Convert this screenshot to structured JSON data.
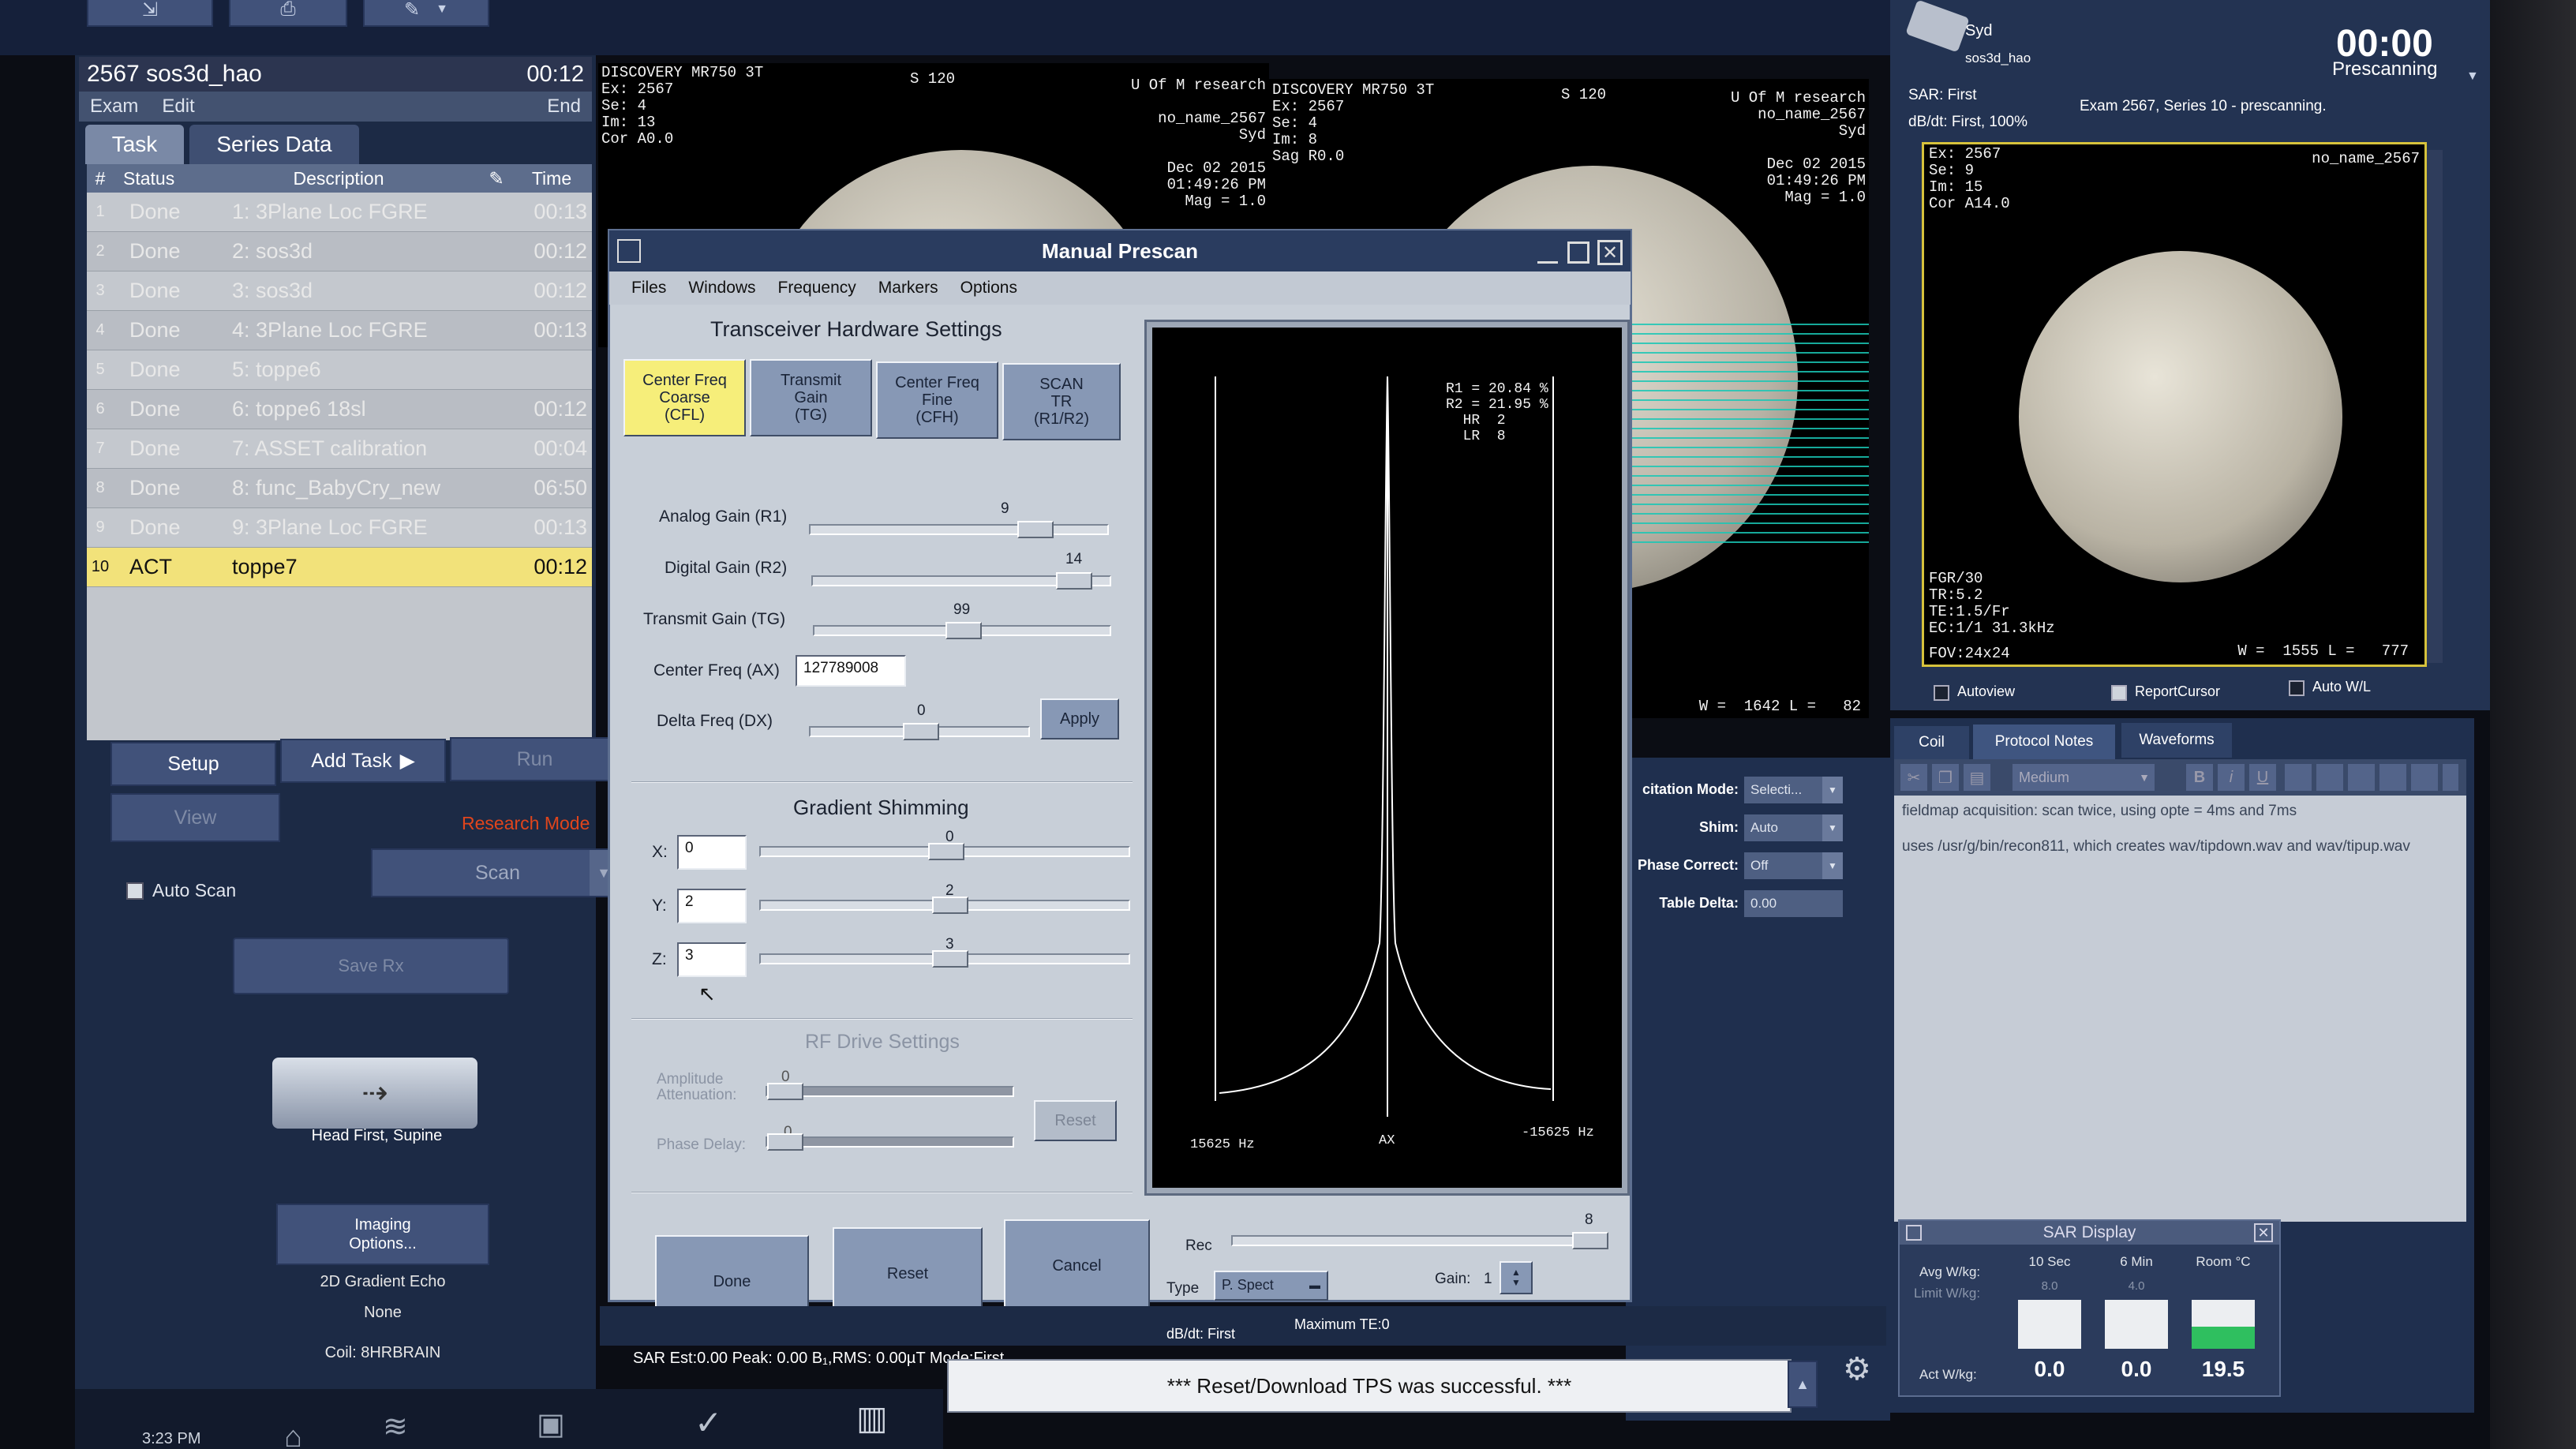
{
  "task_panel": {
    "patient": "2567 sos3d_hao",
    "time": "00:12",
    "menu": [
      "Exam",
      "Edit"
    ],
    "menu_end": "End",
    "tabs": [
      "Task",
      "Series Data"
    ],
    "columns": {
      "num": "#",
      "status": "Status",
      "description": "Description",
      "time": "Time"
    },
    "rows": [
      {
        "num": "1",
        "status": "Done",
        "description": "1: 3Plane Loc FGRE",
        "time": "00:13"
      },
      {
        "num": "2",
        "status": "Done",
        "description": "2: sos3d",
        "time": "00:12"
      },
      {
        "num": "3",
        "status": "Done",
        "description": "3: sos3d",
        "time": "00:12"
      },
      {
        "num": "4",
        "status": "Done",
        "description": "4: 3Plane Loc FGRE",
        "time": "00:13"
      },
      {
        "num": "5",
        "status": "Done",
        "description": "5: toppe6",
        "time": ""
      },
      {
        "num": "6",
        "status": "Done",
        "description": "6: toppe6 18sl",
        "time": "00:12"
      },
      {
        "num": "7",
        "status": "Done",
        "description": "7: ASSET calibration",
        "time": "00:04"
      },
      {
        "num": "8",
        "status": "Done",
        "description": "8: func_BabyCry_new",
        "time": "06:50"
      },
      {
        "num": "9",
        "status": "Done",
        "description": "9: 3Plane Loc FGRE",
        "time": "00:13"
      },
      {
        "num": "10",
        "status": "ACT",
        "description": "toppe7",
        "time": "00:12"
      }
    ],
    "buttons": {
      "setup": "Setup",
      "add_task": "Add Task",
      "run": "Run",
      "view": "View",
      "scan": "Scan"
    },
    "research_mode": "Research Mode",
    "auto_scan": "Auto Scan",
    "save_rx": "Save Rx",
    "position": "Head First, Supine",
    "imaging_options": "Imaging Options...",
    "sequence": "2D Gradient Echo",
    "sequence_opt": "None",
    "coil": "Coil: 8HRBRAIN",
    "clock": "3:23 PM"
  },
  "viewport1": {
    "left_text": "DISCOVERY MR750 3T\nEx: 2567\nSe: 4\nIm: 13\nCor A0.0",
    "top_center": "S 120",
    "right_text": "U Of M research\n\nno_name_2567\nSyd\n\nDec 02 2015\n01:49:26 PM\nMag = 1.0"
  },
  "viewport2": {
    "left_text": "DISCOVERY MR750 3T\nEx: 2567\nSe: 4\nIm: 8\nSag R0.0",
    "top_center": "S 120",
    "right_text": "U Of M research\nno_name_2567\nSyd\n\nDec 02 2015\n01:49:26 PM\nMag = 1.0",
    "bottom": "W =  1642 L =   82"
  },
  "viewport3": {
    "left_text": "Ex: 2567\nSe: 9\nIm: 15\nCor A14.0",
    "right_text": "no_name_2567",
    "bottom_left": "FGR/30\nTR:5.2\nTE:1.5/Fr\nEC:1/1 31.3kHz",
    "fov": "FOV:24x24",
    "wl": "W =  1555 L =   777"
  },
  "status_panel": {
    "user": "Syd",
    "subject": "sos3d_hao",
    "timer": "00:00",
    "state": "Prescanning",
    "sar": "SAR: First",
    "dbdt": "dB/dt: First, 100%",
    "exam_msg": "Exam 2567, Series 10 -  prescanning."
  },
  "viewer_checks": [
    "Autoview",
    "ReportCursor",
    "Auto W/L"
  ],
  "right_tabs": [
    "Coil",
    "Protocol Notes",
    "Waveforms"
  ],
  "notes": {
    "font_size": "Medium",
    "text1": "fieldmap acquisition: scan twice, using opte = 4ms and 7ms",
    "text2": "uses /usr/g/bin/recon811, which creates wav/tipdown.wav and wav/tipup.wav"
  },
  "params": [
    {
      "label": "citation Mode:",
      "value": "Selecti..."
    },
    {
      "label": "Shim:",
      "value": "Auto"
    },
    {
      "label": "Phase Correct:",
      "value": "Off"
    },
    {
      "label": "Table Delta:",
      "value": "0.00"
    }
  ],
  "sar_display": {
    "title": "SAR Display",
    "avg": "Avg W/kg:",
    "limit": "Limit W/kg:",
    "act": "Act W/kg:",
    "cols": [
      "10 Sec",
      "6 Min",
      "Room °C"
    ],
    "limits": [
      "8.0",
      "4.0",
      ""
    ],
    "values": [
      "0.0",
      "0.0",
      "19.5"
    ],
    "room_level": 0.45
  },
  "dialog": {
    "title": "Manual Prescan",
    "menu": [
      "Files",
      "Windows",
      "Frequency",
      "Markers",
      "Options"
    ],
    "section_title": "Transceiver Hardware Settings",
    "tabs": [
      "Center Freq\nCoarse\n(CFL)",
      "Transmit\nGain\n(TG)",
      "Center Freq\nFine\n(CFH)",
      "SCAN\nTR\n(R1/R2)"
    ],
    "analog_gain": {
      "label": "Analog Gain (R1)",
      "value": "9",
      "level": 0.75
    },
    "digital_gain": {
      "label": "Digital Gain (R2)",
      "value": "14",
      "level": 0.87
    },
    "transmit_gain": {
      "label": "Transmit Gain (TG)",
      "value": "99",
      "level": 0.5
    },
    "center_freq": {
      "label": "Center Freq (AX)",
      "value": "127789008"
    },
    "delta_freq": {
      "label": "Delta Freq (DX)",
      "value": "0",
      "level": 0.5
    },
    "apply": "Apply",
    "gradient_title": "Gradient Shimming",
    "shims": [
      {
        "axis": "X:",
        "value": "0",
        "level": 0.5
      },
      {
        "axis": "Y:",
        "value": "2",
        "level": 0.51
      },
      {
        "axis": "Z:",
        "value": "3",
        "level": 0.51
      }
    ],
    "rf_title": "RF Drive Settings",
    "amplitude_label": "Amplitude\nAttenuation:",
    "amplitude_value": "0",
    "phase_label": "Phase Delay:",
    "phase_value": "0",
    "rf_reset": "Reset",
    "done": "Done",
    "reset": "Reset",
    "cancel": "Cancel",
    "spectrum": {
      "r_text": "R1 = 20.84 %\nR2 = 21.95 %\n  HR  2\n  LR  8",
      "x_left": "15625 Hz",
      "x_center": "AX",
      "x_right": "-15625 Hz"
    },
    "rec_label": "Rec",
    "rec_value": "8",
    "type_label": "Type",
    "type_value": "P. Spect",
    "gain_label": "Gain:",
    "gain_value": "1"
  },
  "bottom": {
    "sar_line": "SAR Est:0.00  Peak: 0.00  B₁,RMS: 0.00µT  Mode:First",
    "dbdt_line": "dB/dt: First",
    "max_line": "Maximum   TE:0",
    "message": "*** Reset/Download TPS was successful. ***"
  }
}
